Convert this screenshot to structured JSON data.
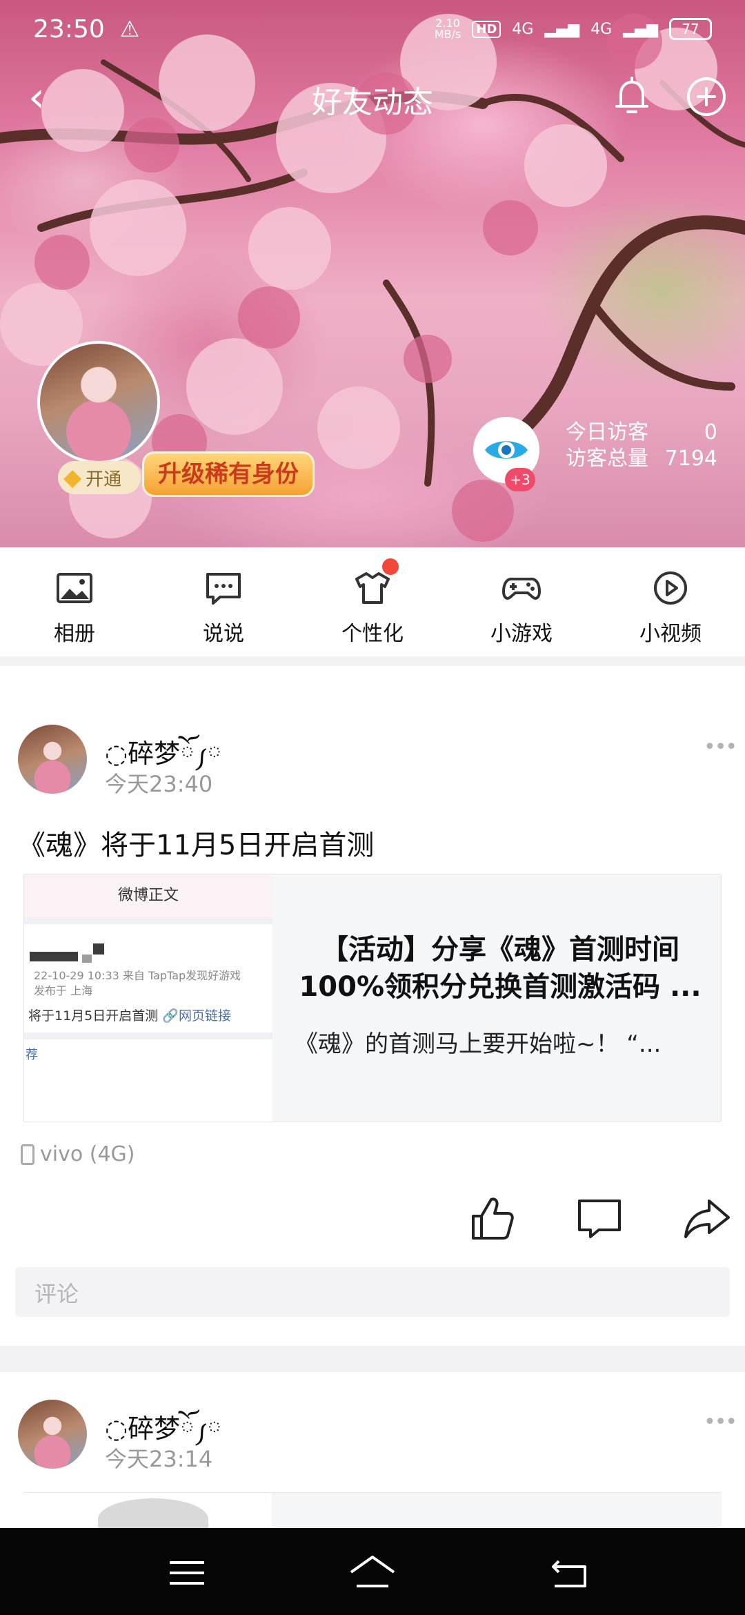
{
  "status_bar": {
    "time": "23:50",
    "warning_icon": "warning-triangle-icon",
    "net_speed_value": "2.10",
    "net_speed_unit": "MB/s",
    "hd_badge": "HD",
    "sim1": "4G",
    "sim2": "4G",
    "battery": "77"
  },
  "header": {
    "title": "好友动态",
    "back_icon": "back-arrow-icon",
    "bell_icon": "bell-icon",
    "add_icon": "plus-circle-icon"
  },
  "profile": {
    "vip_open_label": "开通",
    "upgrade_label": "升级稀有身份",
    "eye_badge": "+3",
    "visitors_today_label": "今日访客",
    "visitors_today_value": "0",
    "visitors_total_label": "访客总量",
    "visitors_total_value": "7194"
  },
  "quick_menu": [
    {
      "label": "相册",
      "icon": "photo-album-icon"
    },
    {
      "label": "说说",
      "icon": "chat-bubble-icon"
    },
    {
      "label": "个性化",
      "icon": "tshirt-icon",
      "has_dot": true
    },
    {
      "label": "小游戏",
      "icon": "gamepad-icon"
    },
    {
      "label": "小视频",
      "icon": "play-circle-icon"
    }
  ],
  "posts": [
    {
      "name": "◌碎梦ོ༿",
      "time": "今天23:40",
      "text": "《魂》将于11月5日开启首测",
      "card": {
        "thumb_header": "微博正文",
        "thumb_meta_1": "22-10-29 10:33  来自 TapTap发现好游戏",
        "thumb_meta_2": "发布于 上海",
        "thumb_line": "将于11月5日开启首测",
        "thumb_link": "🔗网页链接",
        "thumb_foot": "荐",
        "title_line_1": "【活动】分享《魂》首测时间",
        "title_line_2": "100%领积分兑换首测激活码 ...",
        "desc": "《魂》的首测马上要开始啦~！ “..."
      },
      "device": "vivo (4G)",
      "comment_placeholder": "评论"
    },
    {
      "name": "◌碎梦ོ༿",
      "time": "今天23:14"
    }
  ],
  "more_icon_text": "•••"
}
